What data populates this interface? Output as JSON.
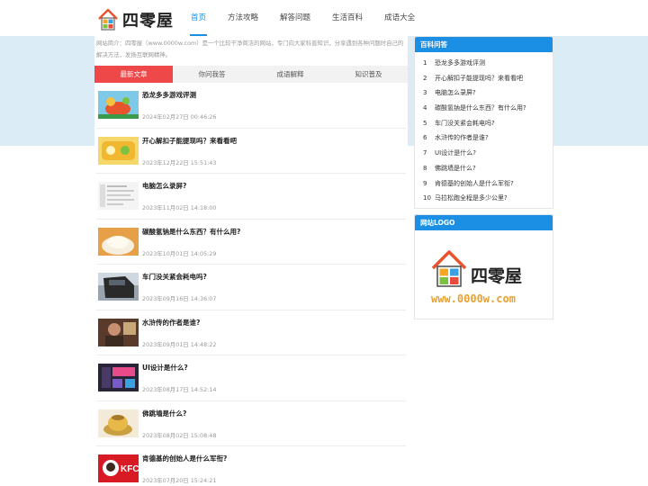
{
  "site": {
    "name": "四零屋",
    "logo_url_text": "www.0000w.com"
  },
  "nav": {
    "items": [
      {
        "label": "首页",
        "active": true
      },
      {
        "label": "方法攻略",
        "active": false
      },
      {
        "label": "解答问题",
        "active": false
      },
      {
        "label": "生活百科",
        "active": false
      },
      {
        "label": "成语大全",
        "active": false
      }
    ]
  },
  "main": {
    "intro": "网站简介：四零屋（www.0000w.com）是一个比较干净简洁的网站，专门向大家科普知识，分享遇到各种问题时自己的解决方法，发扬互联网精神。",
    "tabs": [
      {
        "label": "最新文章",
        "active": true
      },
      {
        "label": "你问我答",
        "active": false
      },
      {
        "label": "成语解释",
        "active": false
      },
      {
        "label": "知识普及",
        "active": false
      }
    ],
    "articles": [
      {
        "title": "恐龙多多游戏评测",
        "date": "2024年02月27日 00:46:26",
        "thumb": "game"
      },
      {
        "title": "开心解扣子能提现吗？来看看吧",
        "date": "2023年12月22日 15:51:43",
        "thumb": "button"
      },
      {
        "title": "电脑怎么录屏?",
        "date": "2023年11月02日 14:18:00",
        "thumb": "screen"
      },
      {
        "title": "碳酸氢钠是什么东西？有什么用?",
        "date": "2023年10月01日 14:05:29",
        "thumb": "powder"
      },
      {
        "title": "车门没关紧会耗电吗?",
        "date": "2023年09月16日 14:36:07",
        "thumb": "car"
      },
      {
        "title": "水浒传的作者是谁?",
        "date": "2023年09月01日 14:48:22",
        "thumb": "portrait"
      },
      {
        "title": "UI设计是什么?",
        "date": "2023年08月17日 14:52:14",
        "thumb": "ui"
      },
      {
        "title": "佛跳墙是什么?",
        "date": "2023年08月02日 15:08:48",
        "thumb": "food"
      },
      {
        "title": "肯德基的创始人是什么军衔?",
        "date": "2023年07月20日 15:24:21",
        "thumb": "kfc"
      }
    ],
    "kfc_text": "KFC"
  },
  "sidebar": {
    "hot_title": "百科问答",
    "hot_items": [
      {
        "num": "1",
        "label": "恐龙多多游戏评测"
      },
      {
        "num": "2",
        "label": "开心解扣子能提现吗？来看看吧"
      },
      {
        "num": "3",
        "label": "电脑怎么录屏?"
      },
      {
        "num": "4",
        "label": "碳酸氢钠是什么东西？有什么用?"
      },
      {
        "num": "5",
        "label": "车门没关紧会耗电吗?"
      },
      {
        "num": "6",
        "label": "水浒传的作者是谁?"
      },
      {
        "num": "7",
        "label": "UI设计是什么?"
      },
      {
        "num": "8",
        "label": "佛跳墙是什么?"
      },
      {
        "num": "9",
        "label": "肯德基的创始人是什么军衔?"
      },
      {
        "num": "10",
        "label": "马拉松跑全程是多少公里?"
      }
    ],
    "logo_title": "网站LOGO"
  },
  "colors": {
    "accent": "#1890e6",
    "tab_active": "#ee4848",
    "box_head": "#1a8fe3",
    "band": "#dcecf7"
  }
}
